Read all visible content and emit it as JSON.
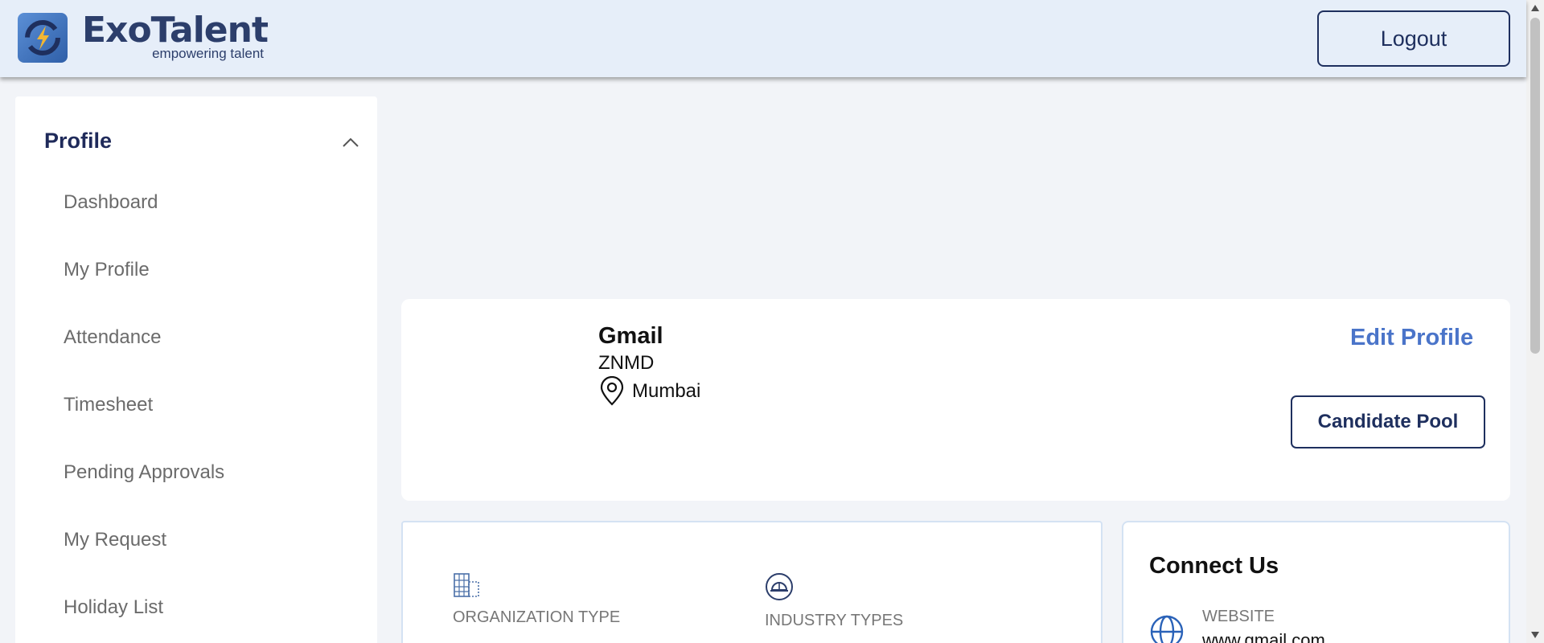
{
  "header": {
    "logo_title": "ExoTalent",
    "logo_tagline": "empowering talent",
    "logout_label": "Logout"
  },
  "sidebar": {
    "section_title": "Profile",
    "items": [
      {
        "label": "Dashboard"
      },
      {
        "label": "My Profile"
      },
      {
        "label": "Attendance"
      },
      {
        "label": "Timesheet"
      },
      {
        "label": "Pending Approvals"
      },
      {
        "label": "My Request"
      },
      {
        "label": "Holiday List"
      }
    ]
  },
  "profile": {
    "company_name": "Gmail",
    "company_subtitle": "ZNMD",
    "location": "Mumbai",
    "edit_label": "Edit Profile",
    "candidate_pool_label": "Candidate Pool"
  },
  "org_info": {
    "organization_type_label": "ORGANIZATION TYPE",
    "industry_types_label": "INDUSTRY TYPES"
  },
  "connect": {
    "title": "Connect Us",
    "website_label": "WEBSITE",
    "website_value": "www.gmail.com"
  },
  "colors": {
    "header_bg": "#e6eef9",
    "primary_navy": "#1e2f5e",
    "link_blue": "#4a74c9",
    "page_bg": "#f2f4f8"
  },
  "icons": [
    "logo-mark-icon",
    "chevron-up-icon",
    "location-pin-icon",
    "building-icon",
    "helmet-icon",
    "globe-icon"
  ]
}
